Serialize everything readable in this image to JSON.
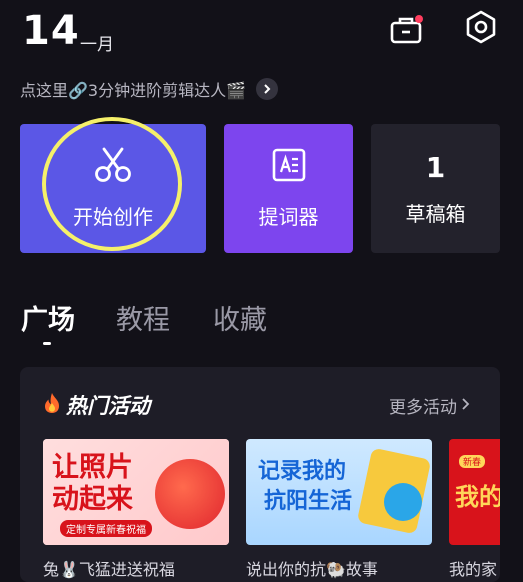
{
  "header": {
    "day": "14",
    "month": "一月"
  },
  "promo": {
    "text": "点这里🔗3分钟进阶剪辑达人🎬"
  },
  "cards": [
    {
      "label": "开始创作",
      "icon": "scissors-icon",
      "color": "#5b57e6"
    },
    {
      "label": "提词器",
      "icon": "teleprompter-icon",
      "color": "#7d45ee"
    },
    {
      "count": "1",
      "label": "草稿箱",
      "color": "#23222c"
    }
  ],
  "tabs": [
    "广场",
    "教程",
    "收藏"
  ],
  "activities": {
    "title": "热门活动",
    "more": "更多活动",
    "items": [
      {
        "caption": "兔🐰飞猛进送祝福",
        "line1": "让照片",
        "line2": "动起来",
        "tag": "定制专属新春祝福"
      },
      {
        "caption": "说出你的抗🐏故事",
        "line1": "记录我的",
        "line2": "抗阳生活"
      },
      {
        "caption": "我的家",
        "line1": "我的",
        "badge": "新春"
      }
    ]
  },
  "colors": {
    "accent_yellow": "#f5f06a",
    "notification_red": "#ff3d5e"
  }
}
